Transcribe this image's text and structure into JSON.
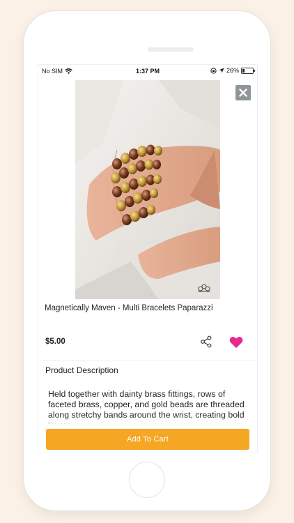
{
  "status_bar": {
    "carrier": "No SIM",
    "time": "1:37 PM",
    "battery": "26%",
    "battery_level": 0.26
  },
  "product": {
    "title": "Magnetically Maven - Multi Bracelets Paparazzi",
    "price": "$5.00",
    "image_icon": "bracelet-photo",
    "carousel_active_index": 0,
    "carousel_count": 2,
    "favorite": true
  },
  "description": {
    "heading": "Product Description",
    "text": "Held together with dainty brass fittings, rows of faceted brass, copper, and gold beads are threaded along stretchy bands around the wrist, creating bold layers."
  },
  "actions": {
    "add_to_cart_label": "Add To Cart",
    "share_icon": "share-icon",
    "favorite_icon": "heart-icon",
    "close_icon": "close-icon"
  },
  "colors": {
    "accent": "#f5a623",
    "heart": "#e6288f",
    "close_bg": "#8e9699",
    "background": "#fbf1e6"
  }
}
